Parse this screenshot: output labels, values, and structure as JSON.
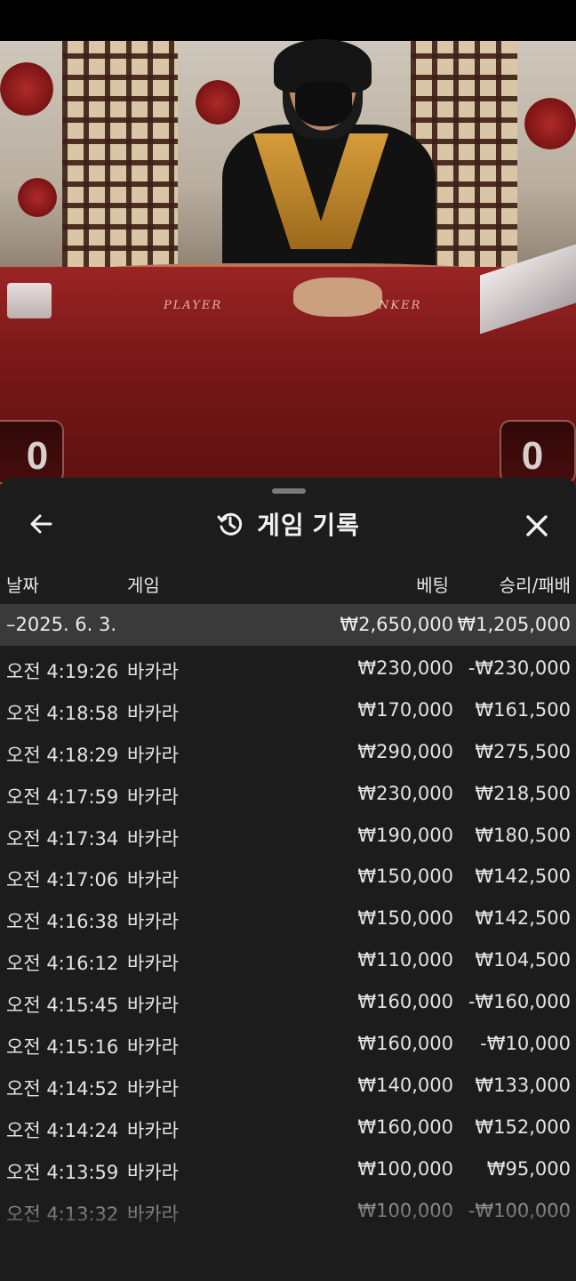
{
  "live_view": {
    "table_labels": {
      "player": "PLAYER",
      "banker": "NKER"
    },
    "player_score": "0",
    "banker_score": "0"
  },
  "sheet": {
    "title": "게임 기록",
    "icons": {
      "back": "arrow-left-icon",
      "history": "history-clock-icon",
      "close": "close-icon"
    },
    "columns": {
      "date": "날짜",
      "game": "게임",
      "bet": "베팅",
      "result": "승리/패배"
    },
    "date_group": {
      "date": "–2025. 6. 3.",
      "total_bet": "₩2,650,000",
      "total_result": "₩1,205,000"
    },
    "records": [
      {
        "time": "오전 4:19:26",
        "game": "바카라",
        "bet": "₩230,000",
        "result": "-₩230,000"
      },
      {
        "time": "오전 4:18:58",
        "game": "바카라",
        "bet": "₩170,000",
        "result": "₩161,500"
      },
      {
        "time": "오전 4:18:29",
        "game": "바카라",
        "bet": "₩290,000",
        "result": "₩275,500"
      },
      {
        "time": "오전 4:17:59",
        "game": "바카라",
        "bet": "₩230,000",
        "result": "₩218,500"
      },
      {
        "time": "오전 4:17:34",
        "game": "바카라",
        "bet": "₩190,000",
        "result": "₩180,500"
      },
      {
        "time": "오전 4:17:06",
        "game": "바카라",
        "bet": "₩150,000",
        "result": "₩142,500"
      },
      {
        "time": "오전 4:16:38",
        "game": "바카라",
        "bet": "₩150,000",
        "result": "₩142,500"
      },
      {
        "time": "오전 4:16:12",
        "game": "바카라",
        "bet": "₩110,000",
        "result": "₩104,500"
      },
      {
        "time": "오전 4:15:45",
        "game": "바카라",
        "bet": "₩160,000",
        "result": "-₩160,000"
      },
      {
        "time": "오전 4:15:16",
        "game": "바카라",
        "bet": "₩160,000",
        "result": "-₩10,000"
      },
      {
        "time": "오전 4:14:52",
        "game": "바카라",
        "bet": "₩140,000",
        "result": "₩133,000"
      },
      {
        "time": "오전 4:14:24",
        "game": "바카라",
        "bet": "₩160,000",
        "result": "₩152,000"
      },
      {
        "time": "오전 4:13:59",
        "game": "바카라",
        "bet": "₩100,000",
        "result": "₩95,000"
      },
      {
        "time": "오전 4:13:32",
        "game": "바카라",
        "bet": "₩100,000",
        "result": "-₩100,000"
      }
    ]
  }
}
